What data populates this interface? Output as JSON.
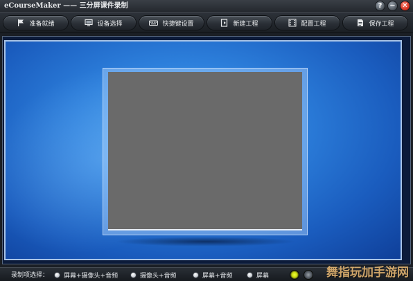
{
  "window": {
    "title": "eCourseMaker —— 三分屏课件录制",
    "help_glyph": "?",
    "minimize_glyph": "−",
    "close_glyph": "✕"
  },
  "toolbar": {
    "buttons": [
      {
        "label": "准备就绪",
        "icon": "flag-icon"
      },
      {
        "label": "设备选择",
        "icon": "monitor-icon"
      },
      {
        "label": "快捷键设置",
        "icon": "keyboard-icon"
      },
      {
        "label": "新建工程",
        "icon": "new-project-icon"
      },
      {
        "label": "配置工程",
        "icon": "film-config-icon"
      },
      {
        "label": "保存工程",
        "icon": "save-document-icon"
      }
    ]
  },
  "bottom_bar": {
    "label": "录制项选择：",
    "options": [
      "屏幕+摄像头+音频",
      "摄像头+音频",
      "屏幕+音频",
      "屏幕"
    ]
  },
  "watermark": "舞指玩加手游网",
  "colors": {
    "stage_blue": "#2d80dc",
    "preview_gray": "#6a6a6a",
    "status_yellow": "#e8f31a",
    "close_red": "#d5311f"
  }
}
